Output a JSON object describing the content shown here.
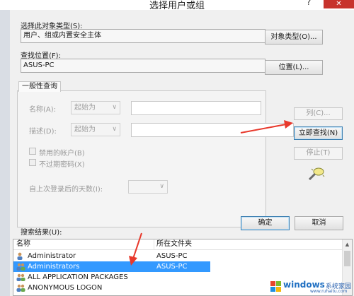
{
  "window": {
    "title": "选择用户或组",
    "help": "?",
    "close": "✕"
  },
  "object_type": {
    "label": "选择此对象类型(S):",
    "value": "用户、组或内置安全主体",
    "button": "对象类型(O)..."
  },
  "location": {
    "label": "查找位置(F):",
    "value": "ASUS-PC",
    "button": "位置(L)..."
  },
  "general_query": {
    "tab": "一般性查询",
    "name_label": "名称(A):",
    "name_mode": "起始为",
    "desc_label": "描述(D):",
    "desc_mode": "起始为",
    "disabled_accounts": "禁用的帐户(B)",
    "non_expiring_pw": "不过期密码(X)",
    "days_since_logon": "自上次登录后的天数(I):"
  },
  "side_buttons": {
    "columns": "列(C)...",
    "find_now": "立即查找(N)",
    "stop": "停止(T)"
  },
  "dialog_buttons": {
    "ok": "确定",
    "cancel": "取消"
  },
  "results": {
    "label": "搜索结果(U):",
    "headers": {
      "name": "名称",
      "folder": "所在文件夹"
    },
    "rows": [
      {
        "name": "Administrator",
        "folder": "ASUS-PC",
        "icon": "user-icon"
      },
      {
        "name": "Administrators",
        "folder": "ASUS-PC",
        "icon": "group-icon",
        "selected": true
      },
      {
        "name": "ALL APPLICATION PACKAGES",
        "folder": "",
        "icon": "group-icon"
      },
      {
        "name": "ANONYMOUS LOGON",
        "folder": "",
        "icon": "group-icon"
      }
    ]
  },
  "watermark": {
    "brand": "windows",
    "sub": "系统家园",
    "url": "www.ruhaitu.com"
  },
  "colors": {
    "accent": "#3399ff",
    "arrow": "#e8392c",
    "close": "#c7332c"
  }
}
